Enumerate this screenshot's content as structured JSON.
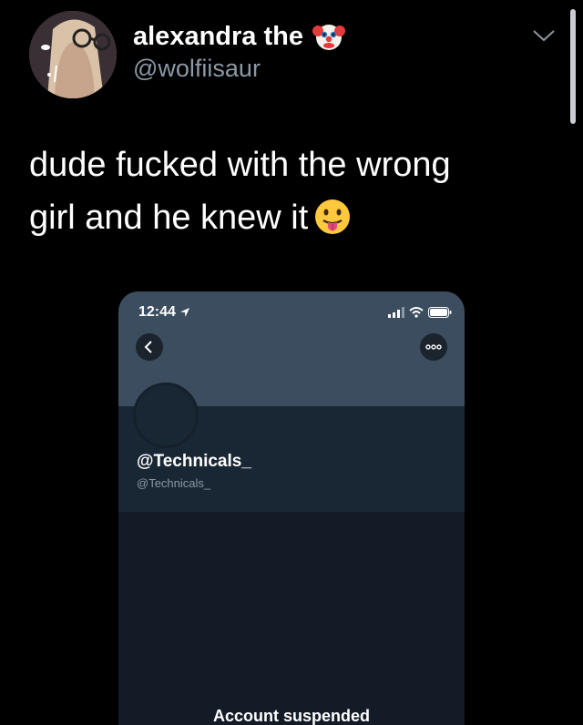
{
  "tweet": {
    "display_name": "alexandra the",
    "name_emoji": "clown-face-emoji",
    "handle": "@wolfiisaur",
    "text_line1": "dude fucked with the wrong",
    "text_line2": "girl and he knew it",
    "text_emoji": "face-with-tongue-emoji"
  },
  "embedded_screenshot": {
    "status_time": "12:44",
    "profile_name": "@Technicals_",
    "profile_handle": "@Technicals_",
    "suspended_text": "Account suspended"
  },
  "colors": {
    "background": "#000000",
    "handle_gray": "#8b98a5",
    "banner": "#3b4d5f",
    "dark_panel": "#15202b"
  }
}
